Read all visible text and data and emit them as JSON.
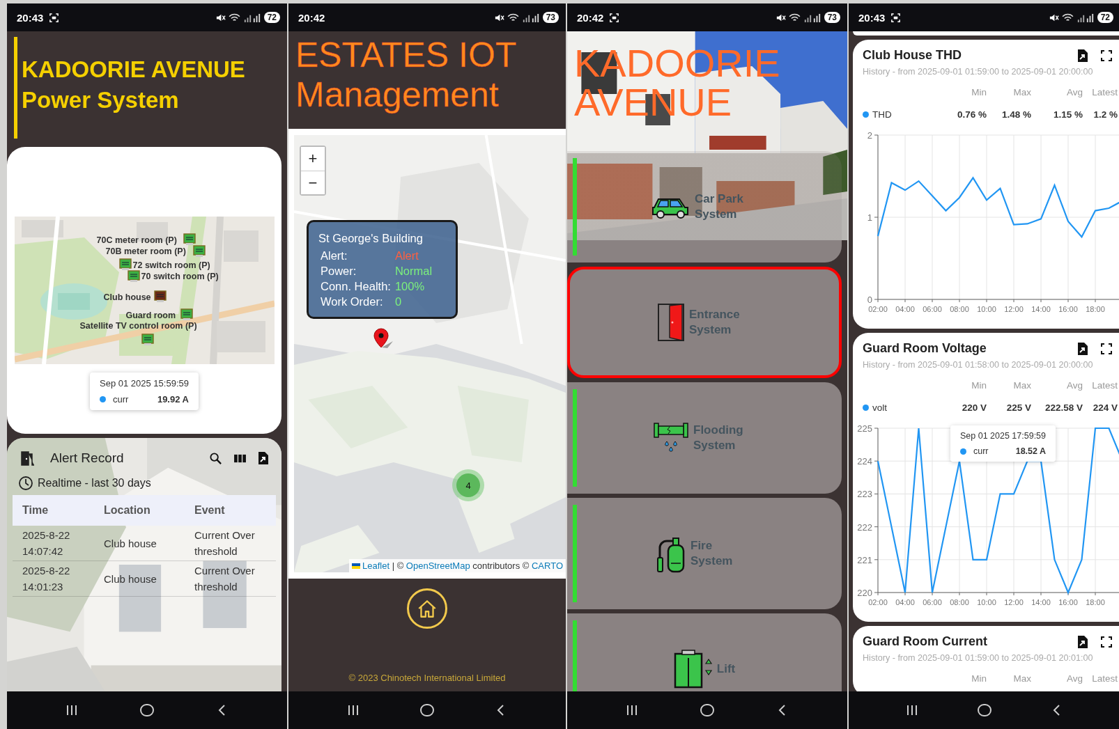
{
  "screens": [
    {
      "kind": "power",
      "status_bar": {
        "time": "20:43",
        "recording": true,
        "battery": "72"
      },
      "title": "KADOORIE AVENUE Power System",
      "map": {
        "points": [
          {
            "label": "70C meter room (P)",
            "alert": false
          },
          {
            "label": "70B meter room (P)",
            "alert": false
          },
          {
            "label": "72 switch room (P)",
            "alert": false
          },
          {
            "label": "70 switch room (P)",
            "alert": false
          },
          {
            "label": "Club house",
            "alert": true
          },
          {
            "label": "Guard room",
            "alert": false
          },
          {
            "label": "Satellite TV control room (P)",
            "alert": false
          }
        ],
        "tooltip": {
          "time": "Sep 01 2025 15:59:59",
          "series": "curr",
          "value": "19.92 A"
        }
      },
      "alert_record": {
        "title": "Alert Record",
        "subtitle": "Realtime - last 30 days",
        "columns": [
          "Time",
          "Location",
          "Event"
        ],
        "rows": [
          {
            "time": "2025-8-22 14:07:42",
            "location": "Club house",
            "event": "Current Over threshold"
          },
          {
            "time": "2025-8-22 14:01:23",
            "location": "Club house",
            "event": "Current Over threshold"
          }
        ]
      }
    },
    {
      "kind": "map",
      "status_bar": {
        "time": "20:42",
        "recording": false,
        "battery": "73"
      },
      "title": "ESTATES IOT Management",
      "map": {
        "zoom_in": "+",
        "zoom_out": "−",
        "popup": {
          "title": "St George's Building",
          "rows": [
            {
              "label": "Alert:",
              "value": "Alert",
              "alert": true
            },
            {
              "label": "Power:",
              "value": "Normal",
              "alert": false
            },
            {
              "label": "Conn. Health:",
              "value": "100%",
              "alert": false
            },
            {
              "label": "Work Order:",
              "value": "0",
              "alert": false
            }
          ]
        },
        "cluster": "4",
        "attribution": [
          {
            "text": "Leaflet",
            "link": true
          },
          {
            "text": " | © ",
            "link": false
          },
          {
            "text": "OpenStreetMap",
            "link": true
          },
          {
            "text": " contributors © ",
            "link": false
          },
          {
            "text": "CARTO",
            "link": true
          }
        ]
      },
      "footer": "© 2023 Chinotech International Limited"
    },
    {
      "kind": "systems",
      "status_bar": {
        "time": "20:42",
        "recording": true,
        "battery": "73"
      },
      "title": "KADOORIE AVENUE",
      "systems": [
        {
          "kind": "car_park",
          "label": "Car Park System",
          "alert": false
        },
        {
          "kind": "entrance",
          "label": "Entrance System",
          "alert": true
        },
        {
          "kind": "flooding",
          "label": "Flooding System",
          "alert": false
        },
        {
          "kind": "fire",
          "label": "Fire System",
          "alert": false
        },
        {
          "kind": "lift",
          "label": "Lift",
          "alert": false
        }
      ]
    },
    {
      "kind": "charts",
      "status_bar": {
        "time": "20:43",
        "recording": true,
        "battery": "72"
      },
      "cards": [
        {
          "title": "Club House THD",
          "subtitle": "History - from 2025-09-01 01:59:00 to 2025-09-01 20:00:00",
          "stat_columns": [
            "Min",
            "Max",
            "Avg",
            "Latest"
          ],
          "stats": [
            {
              "values": [
                "0.76 %",
                "1.48 %",
                "1.15 %",
                "1.2 %"
              ]
            }
          ],
          "chart_data": {
            "type": "line",
            "x": [
              2,
              3,
              4,
              5,
              6,
              7,
              8,
              9,
              10,
              11,
              12,
              13,
              14,
              15,
              16,
              17,
              18,
              19,
              20
            ],
            "series": [
              {
                "name": "THD",
                "color": "#2196f3",
                "values": [
                  0.77,
                  1.42,
                  1.33,
                  1.44,
                  1.26,
                  1.08,
                  1.24,
                  1.48,
                  1.21,
                  1.35,
                  0.91,
                  0.92,
                  0.98,
                  1.39,
                  0.95,
                  0.76,
                  1.08,
                  1.11,
                  1.2
                ]
              }
            ],
            "xlim": [
              2,
              20
            ],
            "ylim": [
              0,
              2
            ],
            "grid": true,
            "xticks": [
              {
                "value": 2,
                "label": "02:00"
              },
              {
                "value": 4,
                "label": "04:00"
              },
              {
                "value": 6,
                "label": "06:00"
              },
              {
                "value": 8,
                "label": "08:00"
              },
              {
                "value": 10,
                "label": "10:00"
              },
              {
                "value": 12,
                "label": "12:00"
              },
              {
                "value": 14,
                "label": "14:00"
              },
              {
                "value": 16,
                "label": "16:00"
              },
              {
                "value": 18,
                "label": "18:00"
              }
            ],
            "yticks": [
              0,
              1,
              2
            ]
          }
        },
        {
          "title": "Guard Room Voltage",
          "subtitle": "History - from 2025-09-01 01:58:00 to 2025-09-01 20:00:00",
          "stat_columns": [
            "Min",
            "Max",
            "Avg",
            "Latest"
          ],
          "stats": [
            {
              "values": [
                "220 V",
                "225 V",
                "222.58 V",
                "224 V"
              ]
            }
          ],
          "chart_data": {
            "type": "line",
            "x": [
              2,
              3,
              4,
              5,
              6,
              7,
              8,
              9,
              10,
              11,
              12,
              13,
              14,
              15,
              16,
              17,
              18,
              19,
              20
            ],
            "series": [
              {
                "name": "volt",
                "color": "#2196f3",
                "values": [
                  224,
                  222,
                  220,
                  225,
                  220,
                  222,
                  224,
                  221,
                  221,
                  223,
                  223,
                  224,
                  224,
                  221,
                  220,
                  221,
                  225,
                  225,
                  224
                ]
              }
            ],
            "xlim": [
              2,
              20
            ],
            "ylim": [
              220,
              225
            ],
            "grid": true,
            "xticks": [
              {
                "value": 2,
                "label": "02:00"
              },
              {
                "value": 4,
                "label": "04:00"
              },
              {
                "value": 6,
                "label": "06:00"
              },
              {
                "value": 8,
                "label": "08:00"
              },
              {
                "value": 10,
                "label": "10:00"
              },
              {
                "value": 12,
                "label": "12:00"
              },
              {
                "value": 14,
                "label": "14:00"
              },
              {
                "value": 16,
                "label": "16:00"
              },
              {
                "value": 18,
                "label": "18:00"
              }
            ],
            "yticks": [
              220,
              221,
              222,
              223,
              224,
              225
            ]
          },
          "tooltip": {
            "time": "Sep 01 2025 17:59:59",
            "series": "curr",
            "value": "18.52 A"
          }
        },
        {
          "title": "Guard Room Current",
          "subtitle": "History - from 2025-09-01 01:59:00 to 2025-09-01 20:01:00",
          "stat_columns": [
            "Min",
            "Max",
            "Avg",
            "Latest"
          ]
        }
      ]
    }
  ]
}
